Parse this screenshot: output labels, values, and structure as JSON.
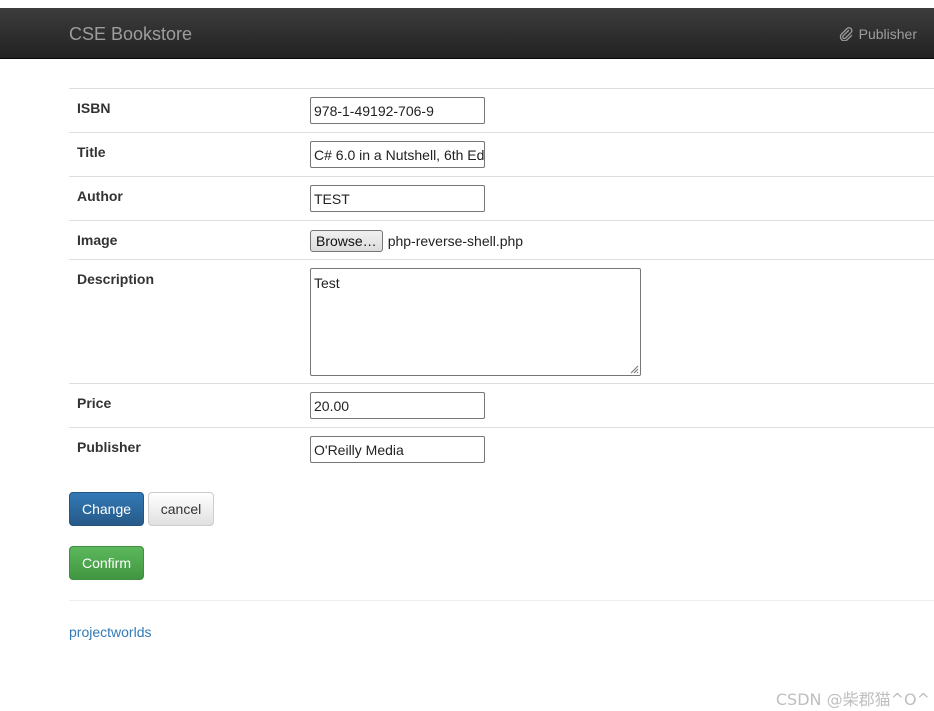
{
  "navbar": {
    "brand": "CSE Bookstore",
    "right_link": {
      "label": "Publisher",
      "icon": "paperclip-icon"
    }
  },
  "form": {
    "rows": [
      {
        "label": "ISBN",
        "value": "978-1-49192-706-9"
      },
      {
        "label": "Title",
        "value": "C# 6.0 in a Nutshell, 6th Ed"
      },
      {
        "label": "Author",
        "value": "TEST"
      },
      {
        "label": "Image",
        "button": "Browse…",
        "file": "php-reverse-shell.php"
      },
      {
        "label": "Description",
        "value": "Test"
      },
      {
        "label": "Price",
        "value": "20.00"
      },
      {
        "label": "Publisher",
        "value": "O'Reilly Media"
      }
    ]
  },
  "actions": {
    "change": "Change",
    "cancel": "cancel",
    "confirm": "Confirm"
  },
  "footer": {
    "link": "projectworlds"
  },
  "watermark": "CSDN @柴郡猫^O^",
  "colors": {
    "navbar": "#222222",
    "primary": "#337ab7",
    "success": "#5cb85c",
    "link": "#337ab7"
  }
}
